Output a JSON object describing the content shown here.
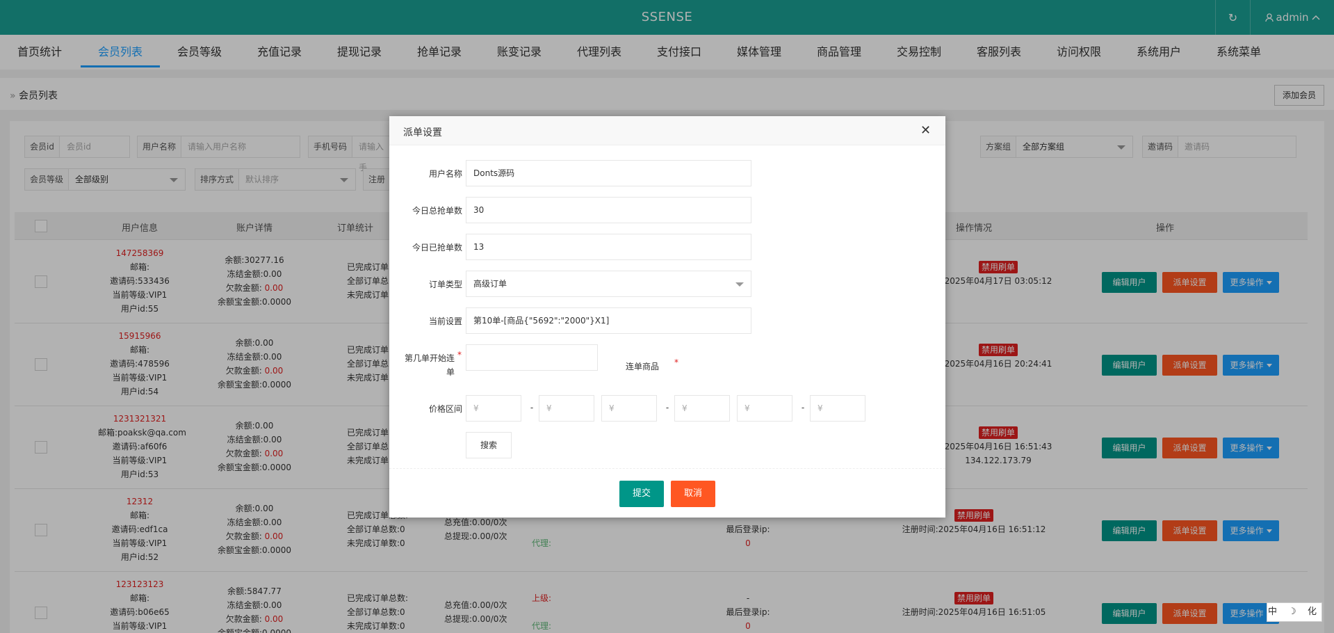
{
  "header": {
    "brand": "SSENSE",
    "refresh_icon": "↻",
    "user": "admin"
  },
  "nav": [
    "首页统计",
    "会员列表",
    "会员等级",
    "充值记录",
    "提现记录",
    "抢单记录",
    "账变记录",
    "代理列表",
    "支付接口",
    "媒体管理",
    "商品管理",
    "交易控制",
    "客服列表",
    "访问权限",
    "系统用户",
    "系统菜单"
  ],
  "breadcrumb": {
    "label": "会员列表",
    "add_button": "添加会员"
  },
  "filters": {
    "member_id": {
      "label": "会员id",
      "placeholder": "会员id"
    },
    "username": {
      "label": "用户名称",
      "placeholder": "请输入用户名称"
    },
    "phone": {
      "label": "手机号码",
      "placeholder": "请输入手"
    },
    "plan": {
      "label": "方案组",
      "value": "全部方案组"
    },
    "invite": {
      "label": "邀请码",
      "placeholder": "邀请码"
    },
    "level": {
      "label": "会员等级",
      "value": "全部级别"
    },
    "sort": {
      "label": "排序方式",
      "placeholder": "默认排序"
    },
    "register": {
      "label": "注册"
    }
  },
  "table": {
    "headers": {
      "user": "用户信息",
      "account": "账户详情",
      "orders": "订单统计",
      "ops_info": "操作情况",
      "actions": "操作"
    },
    "rows": [
      {
        "phone": "147258369",
        "email": "邮箱:",
        "invite": "邀请码:533436",
        "level": "当前等级:VIP1",
        "uid": "用户id:55",
        "balance": "余额:30277.16",
        "frozen": "冻结金额:0.00",
        "debt_label": "欠款金额:",
        "debt": "0.00",
        "yeb": "余额宝金额:0.0000",
        "o1": "已完成订单",
        "o2": "全部订单总",
        "o3": "未完成订单",
        "badge": "禁用刷单",
        "time": "2025年04月17日 03:05:12",
        "time2": ""
      },
      {
        "phone": "15915966",
        "email": "邮箱:",
        "invite": "邀请码:478596",
        "level": "当前等级:VIP1",
        "uid": "用户id:54",
        "balance": "余额:0.00",
        "frozen": "冻结金额:0.00",
        "debt_label": "欠款金额:",
        "debt": "0.00",
        "yeb": "余额宝金额:0.0000",
        "o1": "已完成订单",
        "o2": "全部订单总",
        "o3": "未完成订单",
        "badge": "禁用刷单",
        "time": "2025年04月16日 20:24:41",
        "time2": ""
      },
      {
        "phone": "1231321321",
        "email": "邮箱:poaksk@qa.com",
        "invite": "邀请码:af60f6",
        "level": "当前等级:VIP1",
        "uid": "用户id:53",
        "balance": "余额:0.00",
        "frozen": "冻结金额:0.00",
        "debt_label": "欠款金额:",
        "debt": "0.00",
        "yeb": "余额宝金额:0.0000",
        "o1": "已完成订单",
        "o2": "全部订单总",
        "o3": "未完成订单",
        "badge": "禁用刷单",
        "time": "2025年04月16日 16:51:43",
        "time2": "134.122.173.79"
      },
      {
        "phone": "12312",
        "email": "邮箱:",
        "invite": "邀请码:edf1ca",
        "level": "当前等级:VIP1",
        "uid": "用户id:52",
        "balance": "余额:0.00",
        "frozen": "冻结金额:0.00",
        "debt_label": "欠款金额:",
        "debt": "0.00",
        "yeb": "余额宝金额:0.0000",
        "o1": "已完成订单总数:",
        "o2": "全部订单总数:0",
        "o3": "未完成订单数:0",
        "total_recharge": "总充值:0.00/0次",
        "total_withdraw": "总提现:0.00/0次",
        "agent": "代理:",
        "login_ip": "最后登录ip:",
        "login_ip_val": "0",
        "badge": "禁用刷单",
        "time": "注册时间:2025年04月16日 16:51:12",
        "time2": ""
      },
      {
        "phone": "123123123",
        "email": "邮箱:",
        "invite": "邀请码:b06e65",
        "level": "当前等级:VIP1",
        "uid": "",
        "balance": "余额:5847.77",
        "frozen": "冻结金额:0.00",
        "debt_label": "欠款金额:",
        "debt": "0.00",
        "yeb": "余额宝金额:0.0000",
        "o1": "已完成订单总数:",
        "o2": "全部订单总数:0",
        "o3": "未完成订单数:0",
        "total_recharge": "总充值:0.00/0次",
        "total_withdraw": "总提现:0.00/0次",
        "superior": "上级:",
        "agent": "代理:",
        "dash": "-",
        "login_ip": "最后登录ip:",
        "login_ip_val": "0",
        "badge": "禁用刷单",
        "time": "注册时间:2025年04月16日 16:51:05",
        "time2": ""
      }
    ],
    "btn_edit": "编辑用户",
    "btn_assign": "派单设置",
    "btn_more": "更多操作"
  },
  "modal": {
    "title": "派单设置",
    "close_icon": "✕",
    "username_label": "用户名称",
    "username_value": "Donts源码",
    "today_total_label": "今日总抢单数",
    "today_total_value": "30",
    "today_done_label": "今日已抢单数",
    "today_done_value": "13",
    "order_type_label": "订单类型",
    "order_type_value": "高级订单",
    "current_label": "当前设置",
    "current_value": "第10单-[商品{\"5692\":\"2000\"}X1]",
    "start_label": "第几单开始连单",
    "combo_label": "连单商品",
    "price_label": "价格区间",
    "yen": "¥",
    "dash": "-",
    "search_btn": "搜索",
    "submit": "提交",
    "cancel": "取消"
  },
  "corner_widget": "中 ☽ 化"
}
